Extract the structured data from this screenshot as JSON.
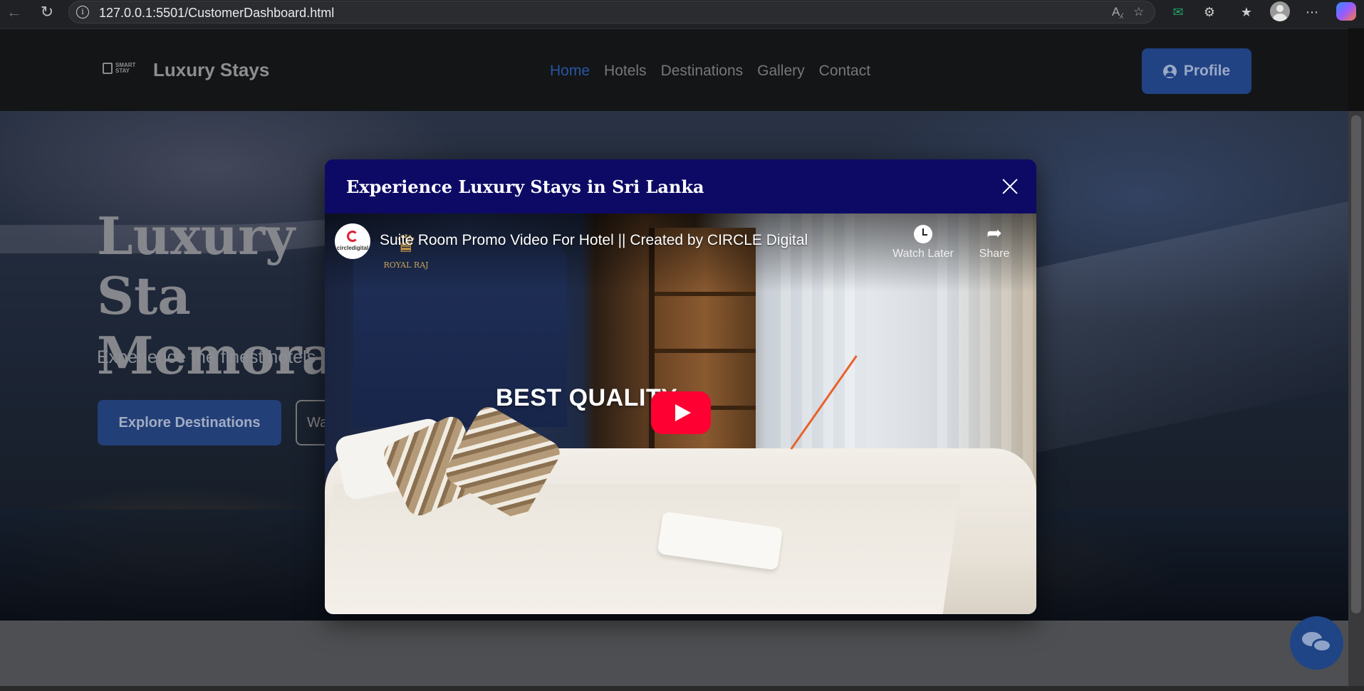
{
  "browser": {
    "url": "127.0.0.1:5501/CustomerDashboard.html"
  },
  "nav": {
    "brand": "Luxury Stays",
    "logo_text": "SMART STAY",
    "items": [
      {
        "label": "Home",
        "active": true
      },
      {
        "label": "Hotels",
        "active": false
      },
      {
        "label": "Destinations",
        "active": false
      },
      {
        "label": "Gallery",
        "active": false
      },
      {
        "label": "Contact",
        "active": false
      }
    ],
    "profile_label": "Profile"
  },
  "hero": {
    "heading": "Luxury Sta\nMemorabl",
    "subtitle": "Experience the finest hotels",
    "explore_label": "Explore Destinations",
    "watch_label": "Wa"
  },
  "modal": {
    "title": "Experience Luxury Stays in Sri Lanka",
    "video": {
      "title": "Suite Room Promo Video For Hotel || Created by CIRCLE Digital",
      "channel_logo_text": "circledigital",
      "brand_mark_text": "ROYAL RAJ",
      "overlay_text": "BEST QUALITY",
      "watch_later_label": "Watch Later",
      "share_label": "Share"
    }
  },
  "colors": {
    "accent": "#2855a3",
    "modal_header": "#0d0a66",
    "play_button": "#ff0033"
  }
}
